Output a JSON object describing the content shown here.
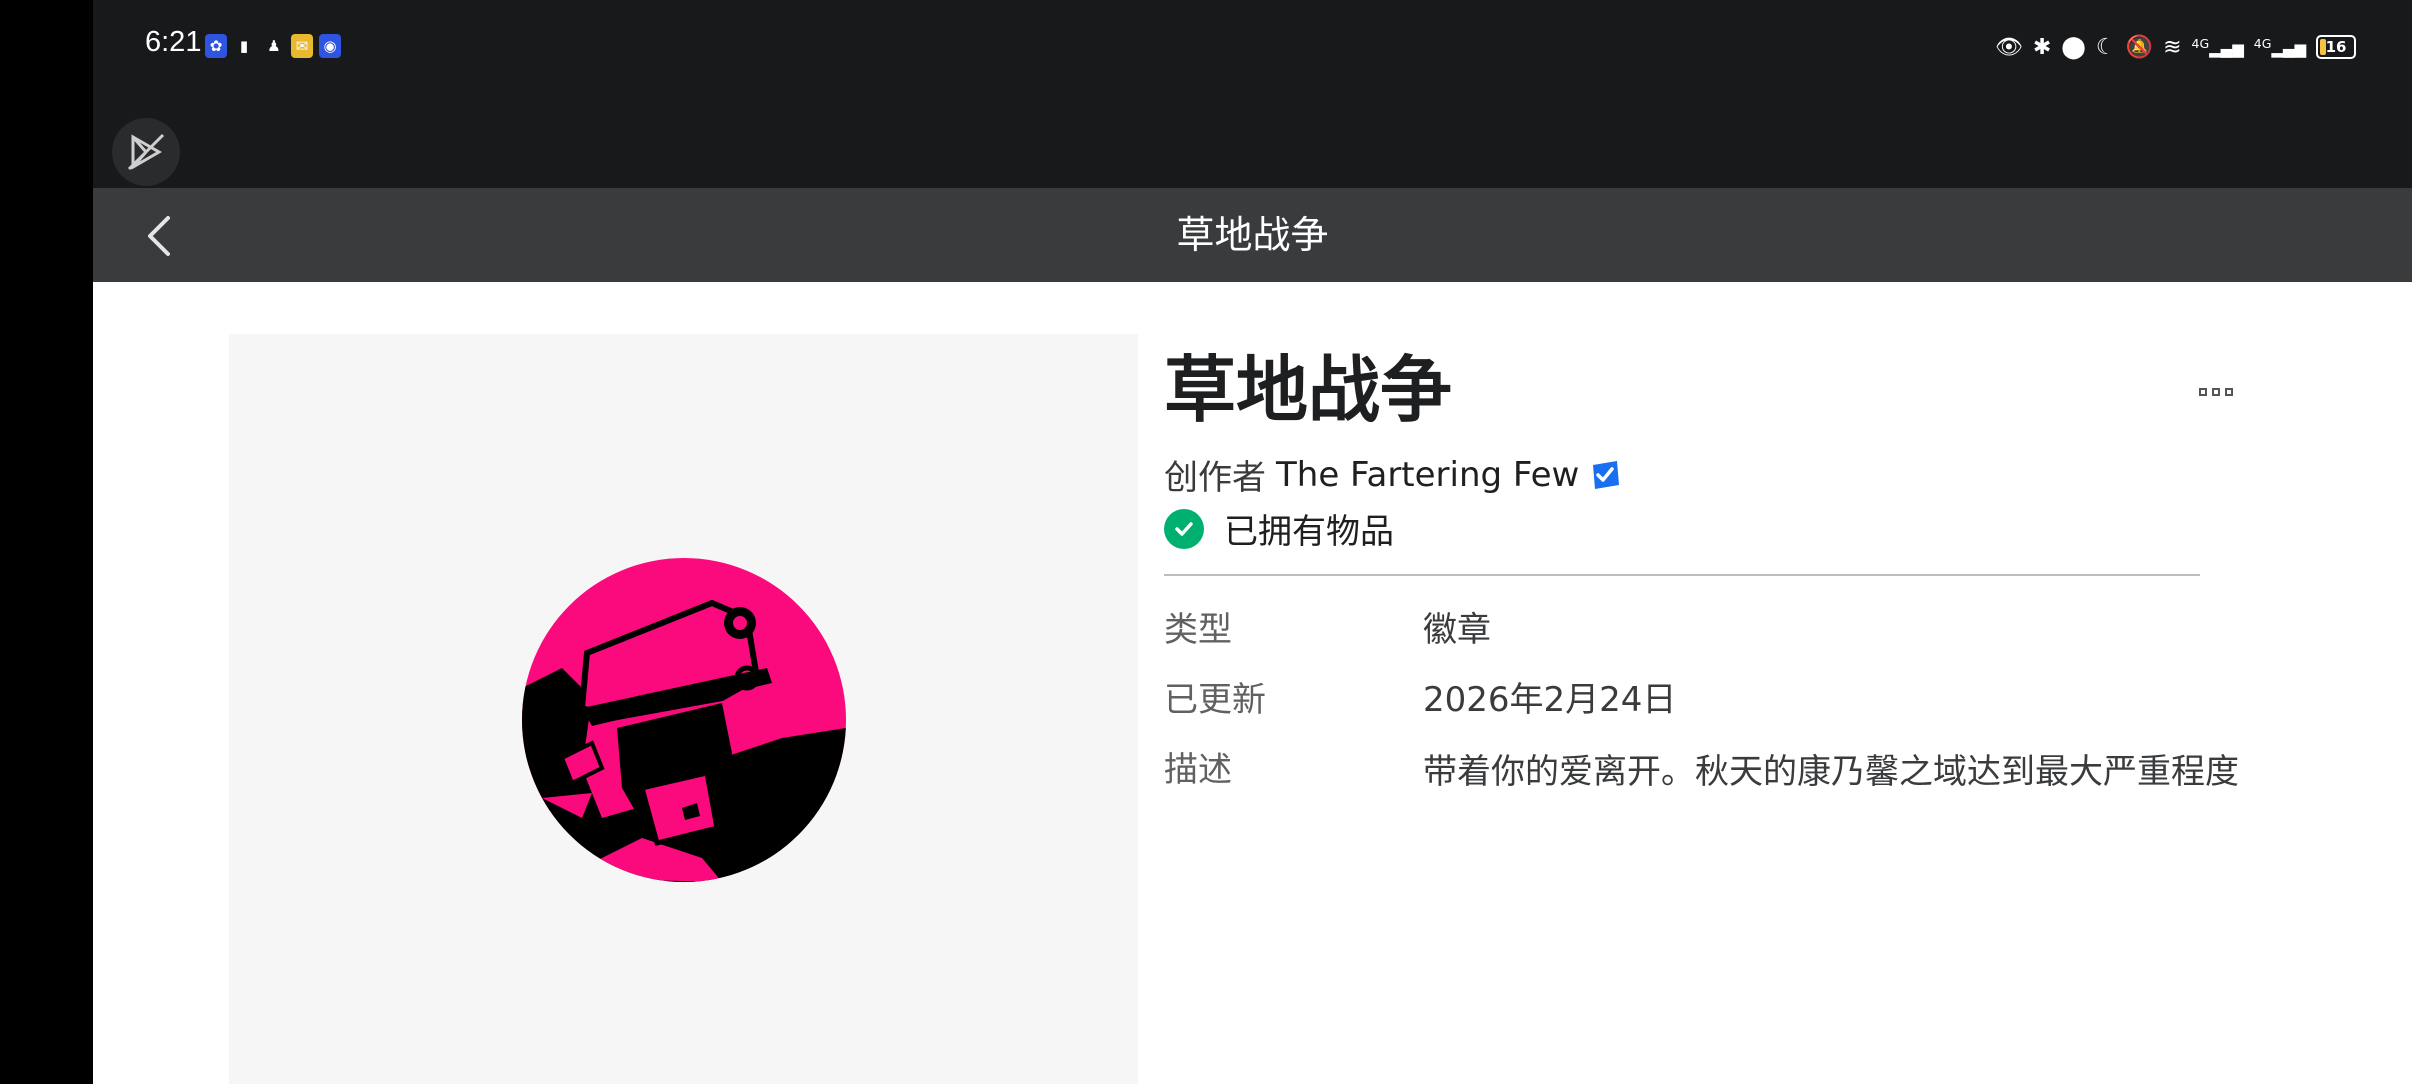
{
  "status_bar": {
    "time": "6:21",
    "battery": "16",
    "network_labels": [
      "4G",
      "4G"
    ],
    "icons_left": [
      "app-icon",
      "battery-alert-icon",
      "qq-icon",
      "mail-icon",
      "shield-icon"
    ],
    "icons_right": [
      "eye-icon",
      "bluetooth-icon",
      "location-icon",
      "moon-icon",
      "mute-icon",
      "wifi-icon",
      "signal-icon",
      "signal-icon",
      "battery-icon"
    ]
  },
  "header": {
    "title": "草地战争"
  },
  "item": {
    "name": "草地战争",
    "creator_prefix": "创作者",
    "creator_name": "The Fartering Few",
    "owned_text": "已拥有物品",
    "details": [
      {
        "label": "类型",
        "value": "徽章"
      },
      {
        "label": "已更新",
        "value": "2026年2月24日"
      },
      {
        "label": "描述",
        "value": "带着你的爱离开。秋天的康乃馨之域达到最大严重程度"
      }
    ]
  },
  "colors": {
    "badge_pink": "#fb0a7d",
    "verified_blue": "#1a6ef0",
    "owned_green": "#00b06f"
  }
}
